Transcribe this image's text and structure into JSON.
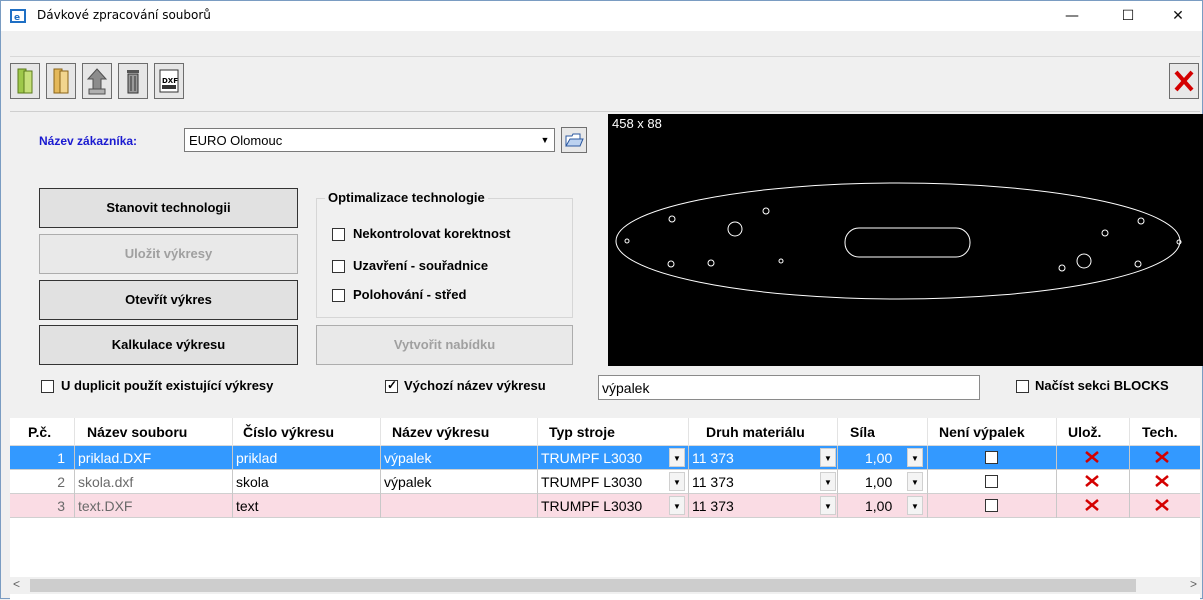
{
  "window": {
    "title": "Dávkové zpracování souborů",
    "minimize": "—",
    "maximize": "☐",
    "close": "✕"
  },
  "toolbar": {
    "icons": [
      "open-folder-icon",
      "folder-icon",
      "recycle-icon",
      "trash-icon",
      "dxf-export-icon",
      "close-red-x-icon"
    ],
    "dxf_label": "DXF"
  },
  "customer": {
    "label": "Název zákazníka:",
    "value": "EURO Olomouc"
  },
  "buttons": {
    "determine_technology": "Stanovit technologii",
    "save_drawings": "Uložit výkresy",
    "open_drawing": "Otevřít výkres",
    "calculate_drawing": "Kalkulace výkresu",
    "create_offer": "Vytvořit nabídku"
  },
  "optimization": {
    "title": "Optimalizace technologie",
    "options": [
      "Nekontrolovat korektnost",
      "Uzavření - souřadnice",
      "Polohování - střed"
    ]
  },
  "preview": {
    "dimensions": "458 x 88"
  },
  "options": {
    "use_existing_duplicates": "U duplicit použít existující výkresy",
    "default_drawing_name": "Výchozí název výkresu",
    "default_drawing_name_checked": true,
    "default_drawing_name_value": "výpalek",
    "load_blocks": "Načíst sekci BLOCKS"
  },
  "grid": {
    "columns": [
      "P.č.",
      "Název souboru",
      "Číslo výkresu",
      "Název výkresu",
      "Typ stroje",
      "Druh materiálu",
      "Síla",
      "Není výpalek",
      "Ulož.",
      "Tech."
    ],
    "rows": [
      {
        "num": "1",
        "file": "priklad.DXF",
        "drawing_no": "priklad",
        "drawing_name": "výpalek",
        "machine": "TRUMPF L3030",
        "material": "11 373",
        "thickness": "1,00",
        "selected": true
      },
      {
        "num": "2",
        "file": "skola.dxf",
        "drawing_no": "skola",
        "drawing_name": "výpalek",
        "machine": "TRUMPF L3030",
        "material": "11 373",
        "thickness": "1,00",
        "selected": false
      },
      {
        "num": "3",
        "file": "text.DXF",
        "drawing_no": "text",
        "drawing_name": "",
        "machine": "TRUMPF L3030",
        "material": "11 373",
        "thickness": "1,00",
        "selected": false
      }
    ]
  },
  "colors": {
    "selection": "#3399ff",
    "row3": "#fadce4",
    "label_blue": "#1a1ad0",
    "x_red": "#d40000"
  }
}
